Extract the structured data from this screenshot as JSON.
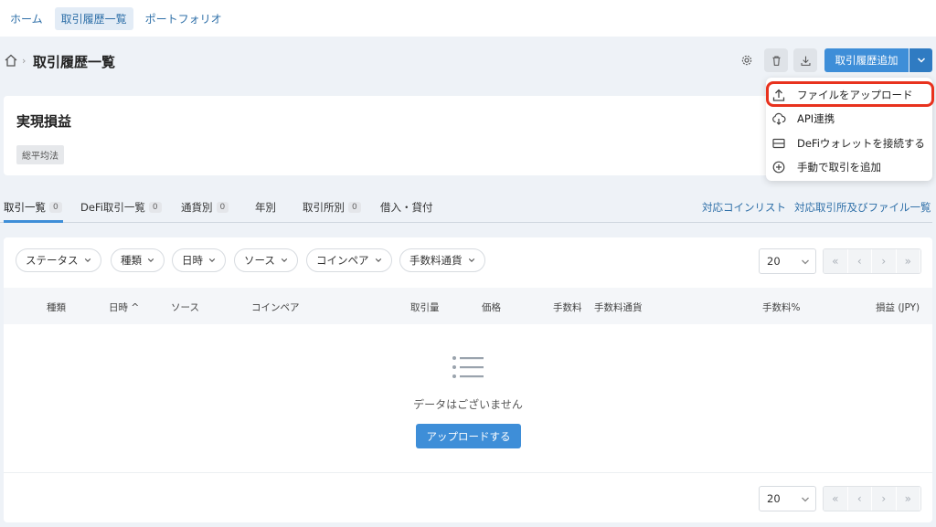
{
  "nav": {
    "tabs": [
      "ホーム",
      "取引履歴一覧",
      "ポートフォリオ"
    ]
  },
  "header": {
    "title": "取引履歴一覧",
    "add_label": "取引履歴追加"
  },
  "summary": {
    "title": "実現損益",
    "tag": "総平均法"
  },
  "tabs": [
    {
      "label": "取引一覧",
      "count": "0"
    },
    {
      "label": "DeFi取引一覧",
      "count": "0"
    },
    {
      "label": "通貨別",
      "count": "0"
    },
    {
      "label": "年別",
      "count": ""
    },
    {
      "label": "取引所別",
      "count": "0"
    },
    {
      "label": "借入・貸付",
      "count": ""
    }
  ],
  "links": [
    "対応コインリスト",
    "対応取引所及びファイル一覧"
  ],
  "filters": [
    "ステータス",
    "種類",
    "日時",
    "ソース",
    "コインペア",
    "手数料通貨"
  ],
  "page_size": "20",
  "table": {
    "columns": [
      "種類",
      "日時 ^",
      "ソース",
      "コインペア",
      "取引量",
      "価格",
      "手数料",
      "手数料通貨",
      "手数料%",
      "損益 (JPY)"
    ],
    "empty_text": "データはございません",
    "upload_label": "アップロードする"
  },
  "dropdown": [
    "ファイルをアップロード",
    "API連携",
    "DeFiウォレットを接続する",
    "手動で取引を追加"
  ],
  "colors": {
    "accent": "#3e8ed8",
    "highlight": "#e8321e"
  }
}
